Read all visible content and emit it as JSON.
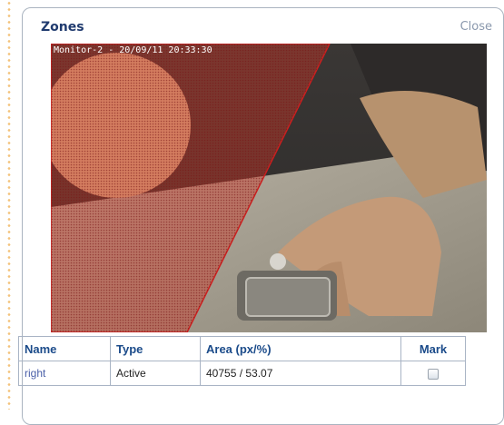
{
  "dialog": {
    "title": "Zones",
    "close_label": "Close"
  },
  "monitor": {
    "overlay_text": "Monitor-2 - 20/09/11 20:33:30"
  },
  "table": {
    "headers": {
      "name": "Name",
      "type": "Type",
      "area": "Area (px/%)",
      "mark": "Mark"
    },
    "rows": [
      {
        "name": "right",
        "type": "Active",
        "area": "40755 / 53.07",
        "mark_checked": false
      }
    ]
  },
  "colors": {
    "title": "#1f3a6e",
    "zone_outline": "#cc1f1f",
    "header_text": "#1b4b8a"
  }
}
